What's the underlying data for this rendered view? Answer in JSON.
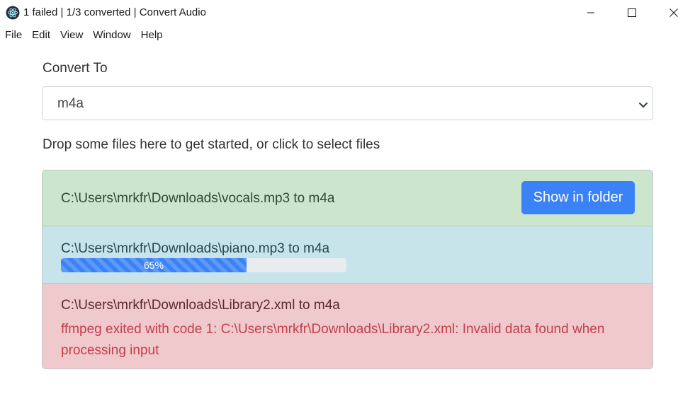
{
  "window": {
    "title": "1 failed | 1/3 converted | Convert Audio",
    "icon": "electron-icon"
  },
  "menu": [
    "File",
    "Edit",
    "View",
    "Window",
    "Help"
  ],
  "form": {
    "convert_label": "Convert To",
    "format_selected": "m4a",
    "dropzone_text": "Drop some files here to get started, or click to select files"
  },
  "files": [
    {
      "status": "success",
      "label": "C:\\Users\\mrkfr\\Downloads\\vocals.mp3 to m4a",
      "action_label": "Show in folder"
    },
    {
      "status": "in-progress",
      "label": "C:\\Users\\mrkfr\\Downloads\\piano.mp3 to m4a",
      "progress": 0.65,
      "progress_label": "65%"
    },
    {
      "status": "failed",
      "label": "C:\\Users\\mrkfr\\Downloads\\Library2.xml to m4a",
      "error": "ffmpeg exited with code 1: C:\\Users\\mrkfr\\Downloads\\Library2.xml: Invalid data found when processing input"
    }
  ],
  "colors": {
    "success_bg": "#cce6cd",
    "info_bg": "#c6e4ea",
    "danger_bg": "#f0c9cc",
    "primary": "#3b82f6",
    "error_text": "#c2404c"
  }
}
